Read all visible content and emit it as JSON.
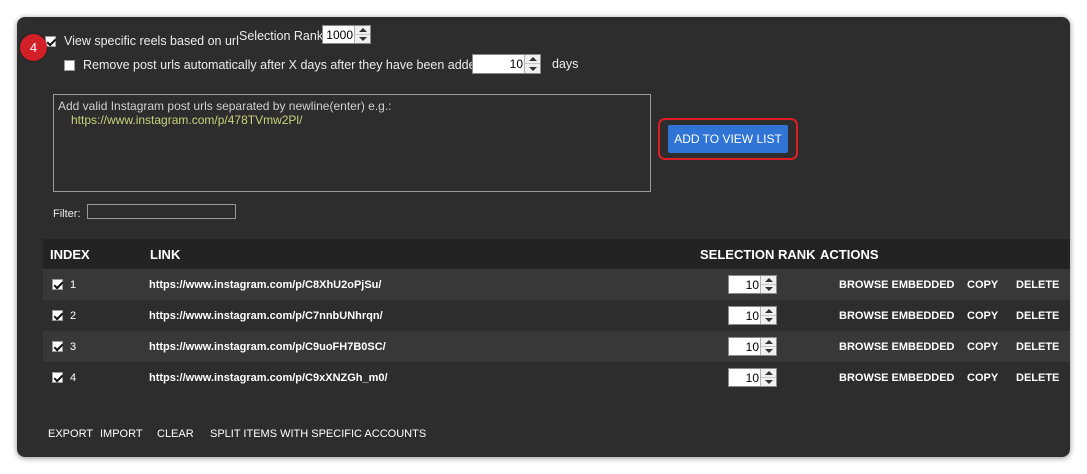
{
  "step_badge": "4",
  "options": {
    "view_specific_label": "View specific reels based on url",
    "view_specific_checked": true,
    "selection_rank_label": "Selection Rank",
    "selection_rank_value": "1000",
    "remove_after_label": "Remove post urls automatically after X days after they have been added",
    "remove_after_checked": false,
    "days_value": "10",
    "days_label": "days"
  },
  "url_input": {
    "hint": "Add valid Instagram post urls separated by newline(enter) e.g.:",
    "example": "https://www.instagram.com/p/478TVmw2Pl/"
  },
  "add_button_label": "ADD TO VIEW LIST",
  "filter_label": "Filter:",
  "filter_value": "",
  "table": {
    "headers": {
      "index": "INDEX",
      "link": "LINK",
      "rank": "SELECTION RANK",
      "actions": "ACTIONS"
    },
    "rows": [
      {
        "checked": true,
        "index": "1",
        "link": "https://www.instagram.com/p/C8XhU2oPjSu/",
        "rank": "10",
        "browse": "BROWSE EMBEDDED",
        "copy": "COPY",
        "delete": "DELETE"
      },
      {
        "checked": true,
        "index": "2",
        "link": "https://www.instagram.com/p/C7nnbUNhrqn/",
        "rank": "10",
        "browse": "BROWSE EMBEDDED",
        "copy": "COPY",
        "delete": "DELETE"
      },
      {
        "checked": true,
        "index": "3",
        "link": "https://www.instagram.com/p/C9uoFH7B0SC/",
        "rank": "10",
        "browse": "BROWSE EMBEDDED",
        "copy": "COPY",
        "delete": "DELETE"
      },
      {
        "checked": true,
        "index": "4",
        "link": "https://www.instagram.com/p/C9xXNZGh_m0/",
        "rank": "10",
        "browse": "BROWSE EMBEDDED",
        "copy": "COPY",
        "delete": "DELETE"
      }
    ]
  },
  "footer": {
    "export": "EXPORT",
    "import": "IMPORT",
    "clear": "CLEAR",
    "split": "SPLIT ITEMS WITH SPECIFIC ACCOUNTS"
  },
  "colors": {
    "panel_bg": "#2d2d2d",
    "accent_button": "#3074d6",
    "highlight_red": "#e01d24",
    "example_url": "#c8d27a"
  }
}
